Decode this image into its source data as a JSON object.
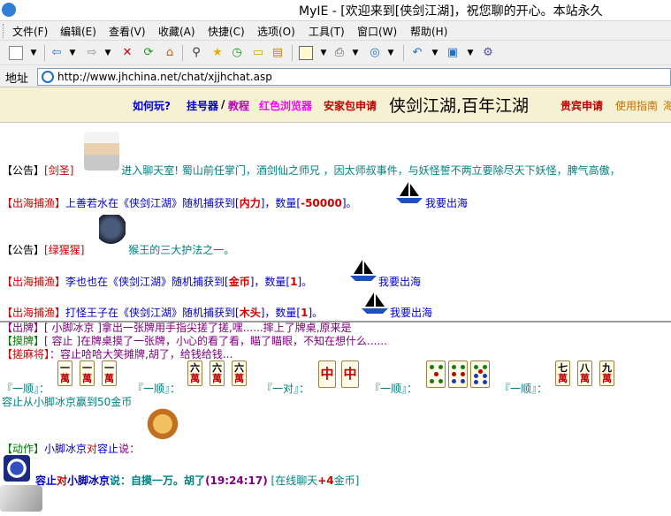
{
  "window": {
    "title": "MyIE - [欢迎来到[侠剑江湖]，祝您聊的开心。本站永久"
  },
  "menu": [
    "文件(F)",
    "编辑(E)",
    "查看(V)",
    "收藏(A)",
    "快捷(C)",
    "选项(O)",
    "工具(T)",
    "窗口(W)",
    "帮助(H)"
  ],
  "address": {
    "label": "地址",
    "url": "http://www.jhchina.net/chat/xjjhchat.asp"
  },
  "nav": {
    "how_to_play": "如何玩?",
    "register": "挂号器",
    "slash": "/",
    "tutorial": "教程",
    "red_browser": "红色浏览器",
    "installer": "安家包申请",
    "slogan": "侠剑江湖,百年江湖",
    "vip": "贵宾申请",
    "guide": "使用指南",
    "extra": "海"
  },
  "messages": {
    "m1": {
      "tag": "【公告】",
      "name": "[剑圣]",
      "text": "进入聊天室! 蜀山前任掌门，酒剑仙之师兄 ，因太师叔事件，与妖怪誓不两立要除尽天下妖怪，脾气高傲，"
    },
    "m2": {
      "tag": "【出海捕渔】",
      "pre": "上善若水在《侠剑江湖》随机捕获到[",
      "item": "内力",
      "mid": "]，数量[",
      "qty": "-50000",
      "post": "]。",
      "ship": "我要出海"
    },
    "m3": {
      "tag": "【公告】",
      "name": "[绿猩猩]",
      "text": "猴王的三大护法之一。"
    },
    "m4": {
      "tag": "【出海捕渔】",
      "pre": "李也也在《侠剑江湖》随机捕获到[",
      "item": "金币",
      "mid": "]，数量[",
      "qty": "1",
      "post": "]。",
      "ship": "我要出海"
    },
    "m5": {
      "tag": "【出海捕渔】",
      "pre": "打怪王子在《侠剑江湖》随机捕获到[",
      "item": "木头",
      "mid": "]，数量[",
      "qty": "1",
      "post": "]。",
      "ship": "我要出海"
    }
  },
  "lower": {
    "l1": "【出牌】[ 小脚冰京 ]拿出一张牌用手指尖搓了搓,嘿......摔上了牌桌,原来是",
    "l2_tag": "【摸牌】",
    "l2": "[ 容止 ]在牌桌摸了一张牌，小心的看了看，瞄了瞄眼，不知在想什么......",
    "l3_tag": "【搓麻将】",
    "l3": "：容止哈哈大笑摊牌,胡了，给钱给钱...",
    "melds": [
      "『一顺』：",
      "『一顺』：",
      "『一对』：",
      "『一顺』：",
      "『一顺』："
    ],
    "tiles": {
      "g1": [
        "一",
        "一",
        "一"
      ],
      "g2": [
        "六",
        "六",
        "六"
      ],
      "g3": [
        "中",
        "中"
      ],
      "g5": [
        "七",
        "八",
        "九"
      ],
      "suit": "萬"
    },
    "win": "容止从小脚冰京赢到50金币",
    "action_tag": "【动作】",
    "action_name": "小脚冰京",
    "action_mid": "对",
    "action_target": "容止",
    "action_verb": "说：",
    "last": {
      "speaker": "容止",
      "mid": "对",
      "target": "小脚冰京",
      "say": "说：自摸一万。胡了",
      "time": "(19:24:17)",
      "bonus_pre": " [在线聊天",
      "bonus": "+4",
      "bonus_post": "金币]"
    }
  }
}
